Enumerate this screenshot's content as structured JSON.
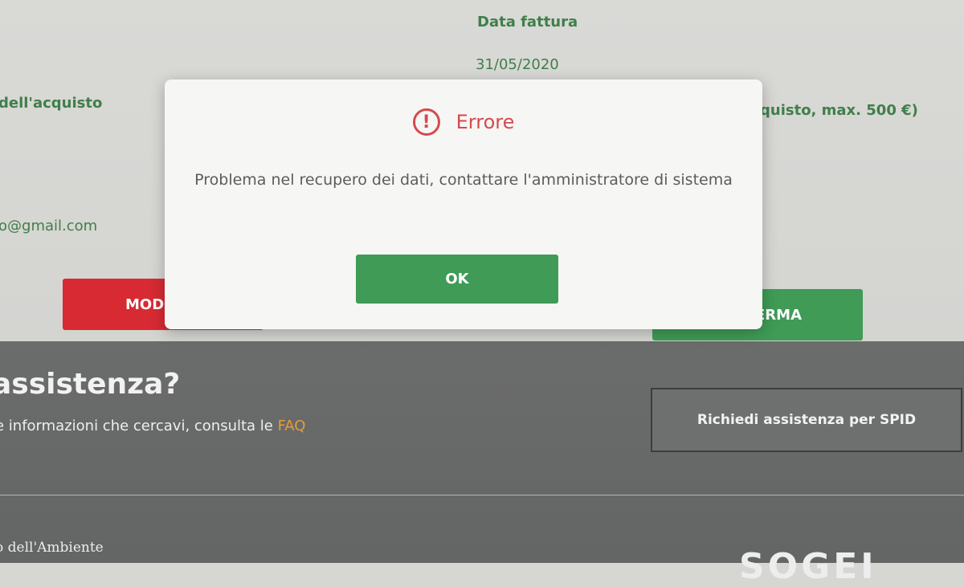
{
  "form": {
    "invoice_date_label": "Data fattura",
    "invoice_date_value": "31/05/2020",
    "purchase_label_partial": "dell'acquisto",
    "amount_label_partial": "quisto, max. 500 €)",
    "email_partial": "o@gmail.com",
    "modify_button_partial": "MODI",
    "confirm_button_partial": "ERMA"
  },
  "help": {
    "title_partial": "assistenza?",
    "text_partial": "e informazioni che cercavi, consulta le ",
    "faq_link": "FAQ",
    "spid_button": "Richiedi assistenza per SPID"
  },
  "footer": {
    "ministry_partial": "o dell'Ambiente",
    "logo_partial": "SOGEI"
  },
  "modal": {
    "title": "Errore",
    "message": "Problema nel recupero dei dati, contattare l'amministratore di sistema",
    "ok_label": "OK",
    "icon": "exclamation-circle-icon",
    "accent_color": "#d54a4d"
  }
}
